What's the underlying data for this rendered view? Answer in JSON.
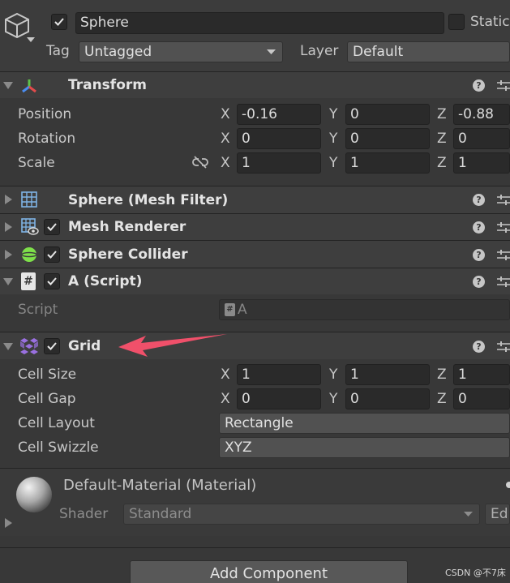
{
  "object": {
    "name": "Sphere",
    "static_label": "Static",
    "tag_label": "Tag",
    "tag_value": "Untagged",
    "layer_label": "Layer",
    "layer_value": "Default"
  },
  "transform": {
    "title": "Transform",
    "rows": [
      {
        "label": "Position",
        "x": "-0.16",
        "y": "0",
        "z": "-0.88"
      },
      {
        "label": "Rotation",
        "x": "0",
        "y": "0",
        "z": "0"
      },
      {
        "label": "Scale",
        "x": "1",
        "y": "1",
        "z": "1"
      }
    ]
  },
  "axes": {
    "x": "X",
    "y": "Y",
    "z": "Z"
  },
  "components": {
    "mesh_filter": "Sphere (Mesh Filter)",
    "mesh_renderer": "Mesh Renderer",
    "sphere_collider": "Sphere Collider",
    "script": "A (Script)",
    "script_label": "Script",
    "script_value": "A",
    "script_icon_glyph": "#"
  },
  "grid": {
    "title": "Grid",
    "cell_size": {
      "label": "Cell Size",
      "x": "1",
      "y": "1",
      "z": "1"
    },
    "cell_gap": {
      "label": "Cell Gap",
      "x": "0",
      "y": "0",
      "z": "0"
    },
    "cell_layout": {
      "label": "Cell Layout",
      "value": "Rectangle"
    },
    "cell_swizzle": {
      "label": "Cell Swizzle",
      "value": "XYZ"
    }
  },
  "material": {
    "name": "Default-Material (Material)",
    "shader_label": "Shader",
    "shader_value": "Standard",
    "edit_label": "Ed"
  },
  "add_component_label": "Add Component",
  "help_glyph": "?",
  "watermark": "CSDN @不7床",
  "colors": {
    "arrow": "#f0506a",
    "panel": "#383838",
    "header": "#3e3e3e",
    "field": "#2a2a2a",
    "collider_icon": "#7ee04a",
    "grid_icon": "#9a70e0"
  }
}
